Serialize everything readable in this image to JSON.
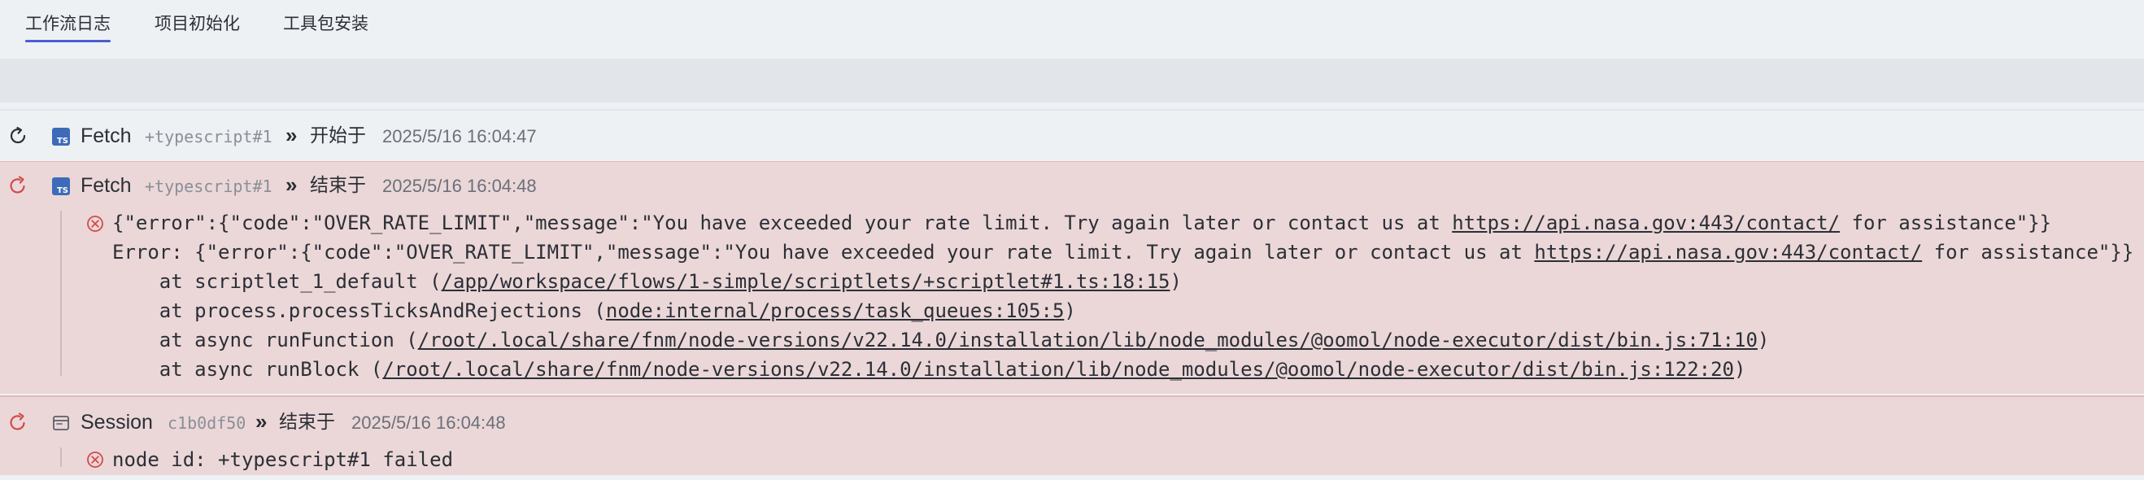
{
  "tabs": [
    {
      "label": "工作流日志",
      "active": true
    },
    {
      "label": "项目初始化",
      "active": false
    },
    {
      "label": "工具包安装",
      "active": false
    }
  ],
  "colors": {
    "accent": "#4a5fd0",
    "error_bg": "#ebd7d8",
    "error_icon": "#d24b4b",
    "ts_badge": "#3d6bb8"
  },
  "entries": [
    {
      "status_icon": "refresh-icon",
      "type_icon": "typescript-icon",
      "name": "Fetch",
      "id": "+typescript#1",
      "arrow": "»",
      "status": "开始于",
      "time": "2025/5/16 16:04:47"
    },
    {
      "status_icon": "error-restart-icon",
      "type_icon": "typescript-icon",
      "name": "Fetch",
      "id": "+typescript#1",
      "arrow": "»",
      "status": "结束于",
      "time": "2025/5/16 16:04:48",
      "logs": {
        "line1_pre": "{\"error\":{\"code\":\"OVER_RATE_LIMIT\",\"message\":\"You have exceeded your rate limit. Try again later or contact us at ",
        "line1_link": "https://api.nasa.gov:443/contact/",
        "line1_post": " for assistance\"}}",
        "line2_pre": "Error: {\"error\":{\"code\":\"OVER_RATE_LIMIT\",\"message\":\"You have exceeded your rate limit. Try again later or contact us at ",
        "line2_link": "https://api.nasa.gov:443/contact/",
        "line2_post": " for assistance\"}}",
        "line3_pre": "    at scriptlet_1_default (",
        "line3_link": "/app/workspace/flows/1-simple/scriptlets/+scriptlet#1.ts:18:15",
        "line3_post": ")",
        "line4_pre": "    at process.processTicksAndRejections (",
        "line4_link": "node:internal/process/task_queues:105:5",
        "line4_post": ")",
        "line5_pre": "    at async runFunction (",
        "line5_link": "/root/.local/share/fnm/node-versions/v22.14.0/installation/lib/node_modules/@oomol/node-executor/dist/bin.js:71:10",
        "line5_post": ")",
        "line6_pre": "    at async runBlock (",
        "line6_link": "/root/.local/share/fnm/node-versions/v22.14.0/installation/lib/node_modules/@oomol/node-executor/dist/bin.js:122:20",
        "line6_post": ")"
      }
    },
    {
      "status_icon": "error-restart-icon",
      "type_icon": "session-icon",
      "name": "Session",
      "id": "c1b0df50",
      "arrow": "»",
      "status": "结束于",
      "time": "2025/5/16 16:04:48",
      "logs": {
        "line1": "node id: +typescript#1 failed"
      }
    }
  ]
}
